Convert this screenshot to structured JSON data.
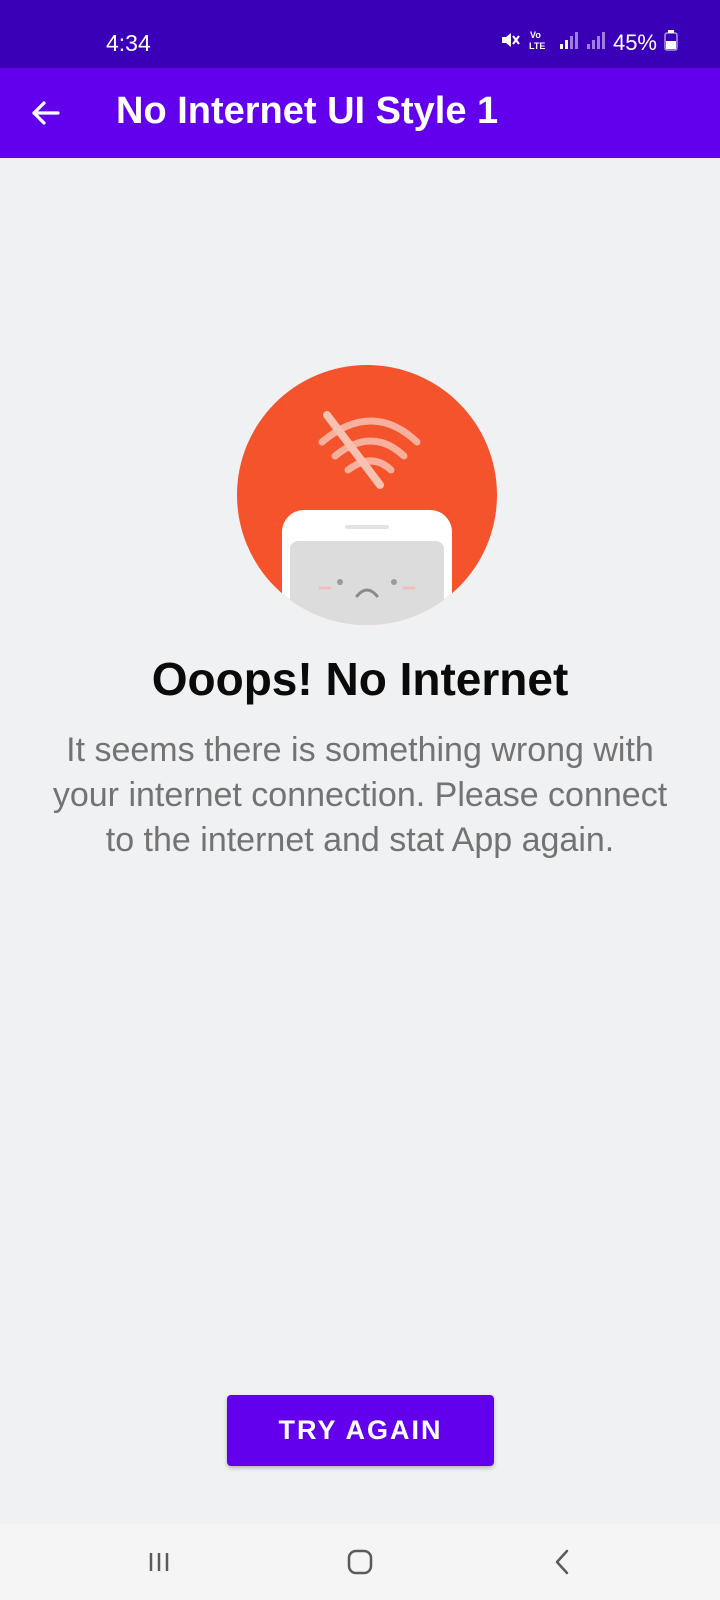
{
  "status_bar": {
    "time": "4:34",
    "battery": "45%",
    "icons": [
      "mute-icon",
      "volte-icon",
      "signal-icon",
      "signal-icon",
      "battery-icon"
    ]
  },
  "app_bar": {
    "title": "No Internet UI Style 1",
    "back_icon": "arrow-back-icon"
  },
  "illustration": {
    "icon": "no-wifi-sad-phone-illustration",
    "circle_color": "#f4532c"
  },
  "content": {
    "headline": "Ooops! No Internet",
    "message": "It seems there is something wrong with your internet connection. Please connect to the internet and stat App again."
  },
  "actions": {
    "try_again_label": "TRY AGAIN"
  },
  "nav_bar": {
    "icons": [
      "recent-apps-icon",
      "home-icon",
      "back-icon"
    ]
  },
  "colors": {
    "status_bar": "#3a00b7",
    "app_bar": "#6200ee",
    "background": "#eff1f3",
    "button": "#6200ee"
  }
}
